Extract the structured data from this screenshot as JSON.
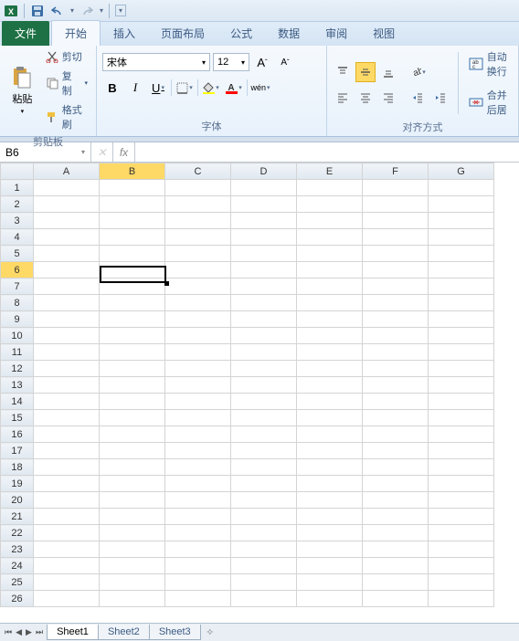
{
  "qat": {
    "dd_glyph": "▾"
  },
  "tabs": {
    "file": "文件",
    "items": [
      "开始",
      "插入",
      "页面布局",
      "公式",
      "数据",
      "审阅",
      "视图"
    ],
    "active": 0
  },
  "ribbon": {
    "clipboard": {
      "paste": "粘贴",
      "cut": "剪切",
      "copy": "复制",
      "format_painter": "格式刷",
      "label": "剪贴板"
    },
    "font": {
      "name": "宋体",
      "size": "12",
      "label": "字体"
    },
    "alignment": {
      "wrap": "自动换行",
      "merge": "合并后居",
      "label": "对齐方式"
    }
  },
  "formula_bar": {
    "cell_ref": "B6",
    "fx": "fx",
    "value": ""
  },
  "grid": {
    "columns": [
      "A",
      "B",
      "C",
      "D",
      "E",
      "F",
      "G"
    ],
    "rows": 26,
    "active_col": 1,
    "active_row": 5
  },
  "sheets": {
    "tabs": [
      "Sheet1",
      "Sheet2",
      "Sheet3"
    ],
    "active": 0
  }
}
